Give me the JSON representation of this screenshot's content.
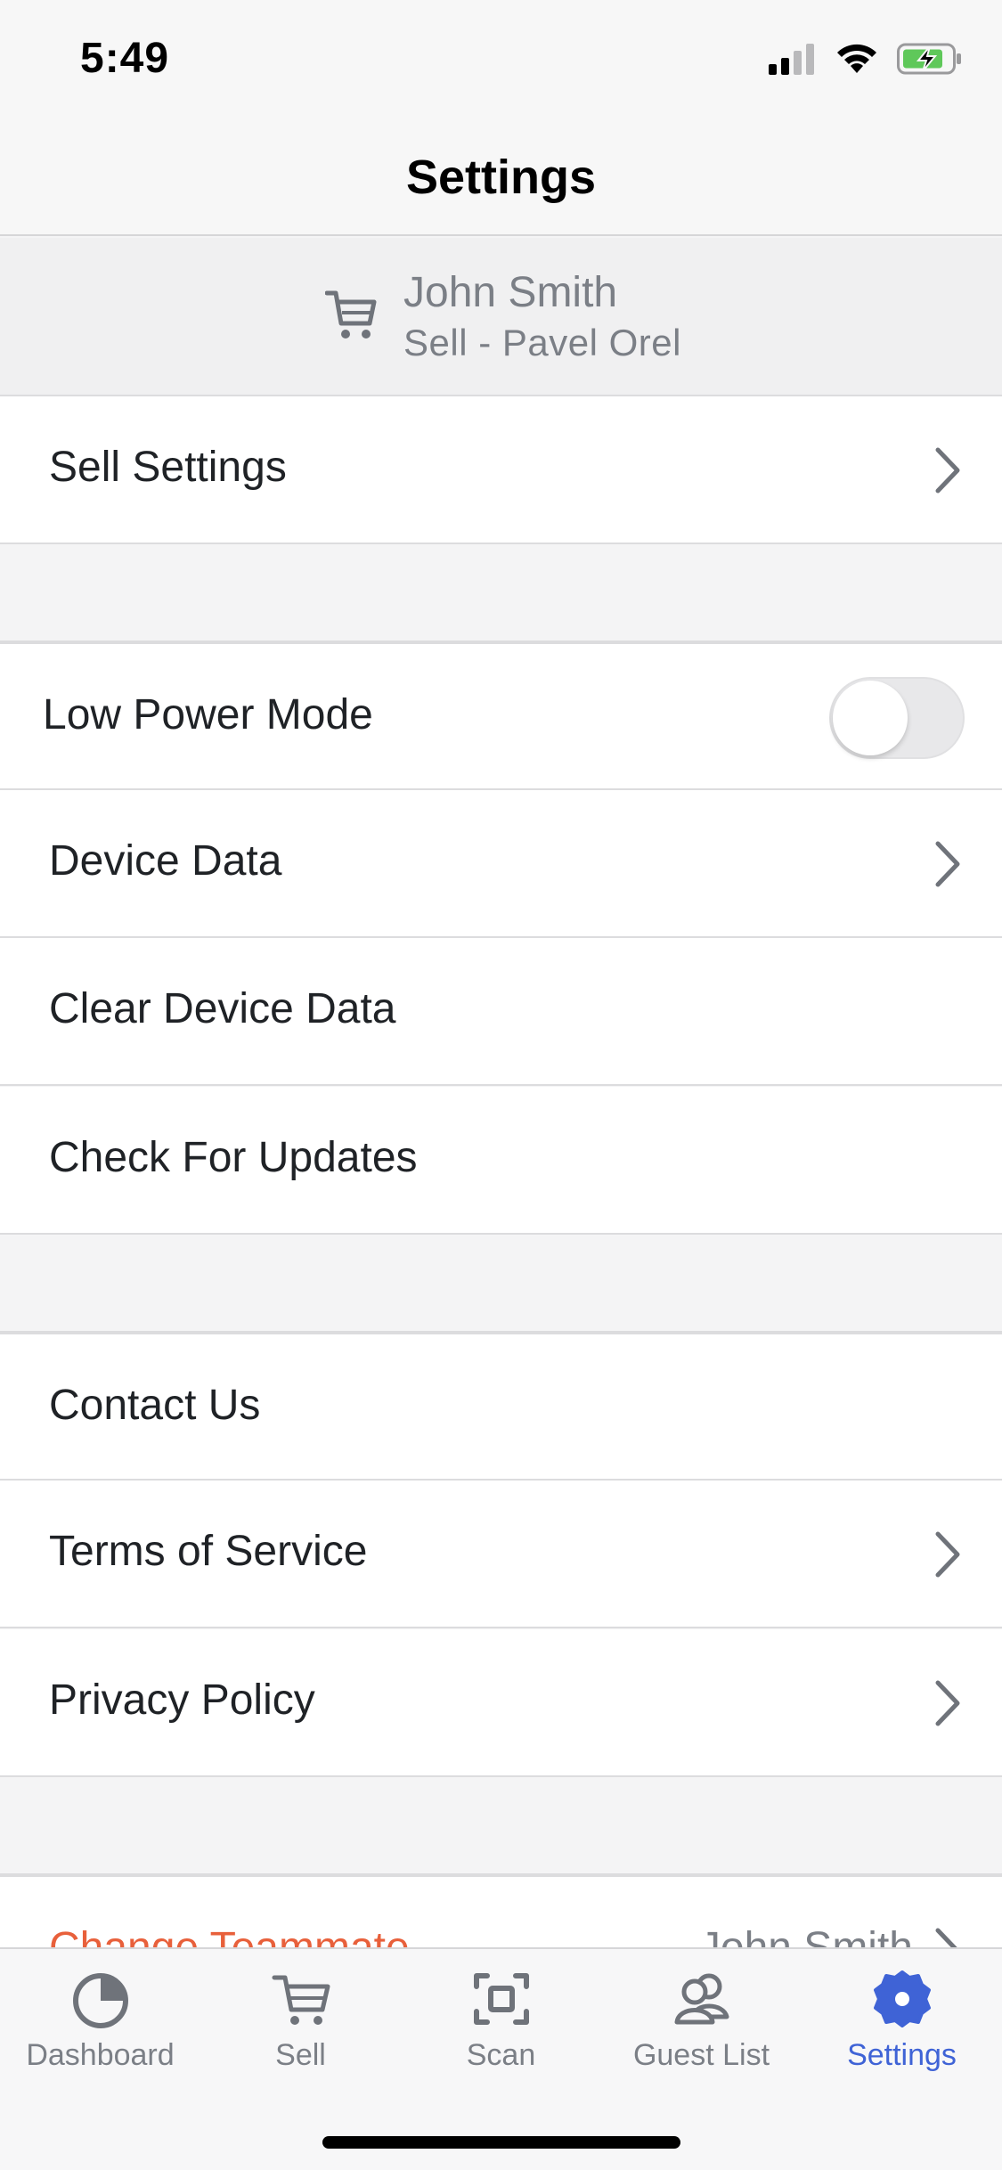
{
  "status_bar": {
    "time": "5:49"
  },
  "nav": {
    "title": "Settings"
  },
  "account": {
    "name": "John Smith",
    "subtitle": "Sell - Pavel Orel",
    "icon": "cart-icon"
  },
  "rows": {
    "sell_settings": "Sell Settings",
    "low_power_mode": "Low Power Mode",
    "device_data": "Device Data",
    "clear_device_data": "Clear Device Data",
    "check_for_updates": "Check For Updates",
    "contact_us": "Contact Us",
    "terms_of_service": "Terms of Service",
    "privacy_policy": "Privacy Policy",
    "change_teammate": "Change Teammate",
    "change_teammate_value": "John Smith"
  },
  "low_power_mode_on": false,
  "tabs": [
    {
      "label": "Dashboard",
      "icon": "pie-chart-icon"
    },
    {
      "label": "Sell",
      "icon": "cart-icon"
    },
    {
      "label": "Scan",
      "icon": "scan-icon"
    },
    {
      "label": "Guest List",
      "icon": "guests-icon"
    },
    {
      "label": "Settings",
      "icon": "gear-icon",
      "active": true
    }
  ],
  "colors": {
    "accent": "#3f63d6",
    "destructive": "#e8603b",
    "secondary_text": "#7b7f86"
  }
}
